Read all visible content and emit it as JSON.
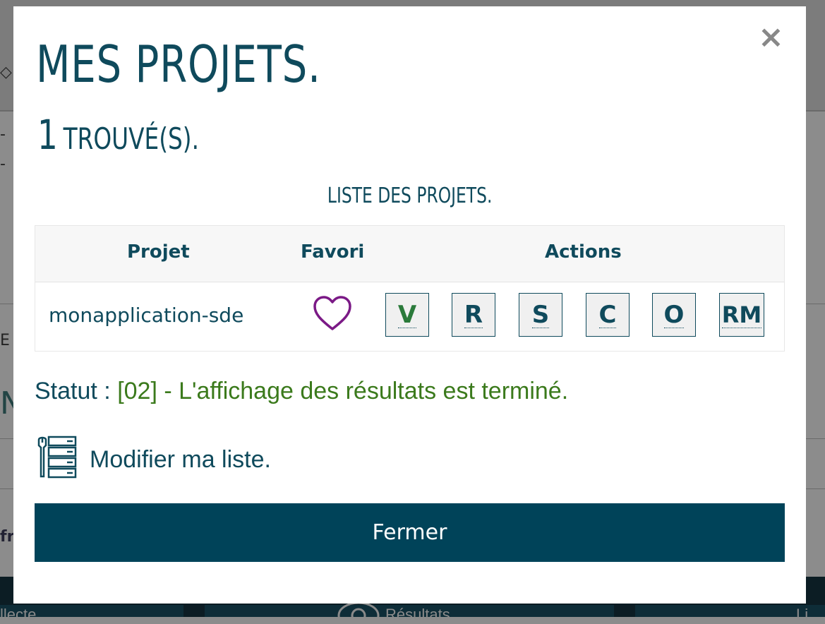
{
  "modal": {
    "close_symbol": "×",
    "title": "MES PROJETS.",
    "count": "1",
    "count_label": "TROUVÉ(S).",
    "list_title": "LISTE DES PROJETS.",
    "table": {
      "headers": {
        "project": "Projet",
        "favorite": "Favori",
        "actions": "Actions"
      },
      "rows": [
        {
          "project": "monapplication-sde",
          "favorite": false,
          "actions": [
            "V",
            "R",
            "S",
            "C",
            "O",
            "RM"
          ]
        }
      ]
    },
    "status_label": "Statut : ",
    "status_value": "[02] - L'affichage des résultats est terminé.",
    "modify_label": "Modifier ma liste.",
    "close_button": "Fermer"
  },
  "background": {
    "tabs": [
      "llecte",
      "Résultats",
      "Li"
    ]
  },
  "colors": {
    "primary": "#004359",
    "text": "#0f4a5c",
    "status_green": "#3b7a1c",
    "favorite_purple": "#7b1a86",
    "overlay": "#8c8c8c"
  },
  "icons": [
    "close-icon",
    "heart-icon",
    "list-tools-icon",
    "eye-icon"
  ]
}
